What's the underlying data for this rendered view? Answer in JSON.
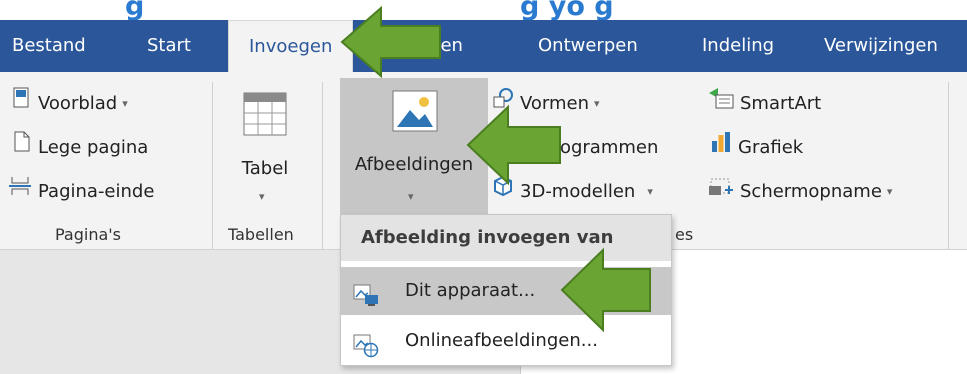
{
  "caption": {
    "left_text": "g",
    "right_text": "g yo   g"
  },
  "tabs": [
    "Bestand",
    "Start",
    "Invoegen",
    "enen",
    "Ontwerpen",
    "Indeling",
    "Verwijzingen"
  ],
  "ribbon": {
    "pages": {
      "cover": "Voorblad",
      "blank": "Lege pagina",
      "break": "Pagina-einde",
      "group": "Pagina's"
    },
    "tables": {
      "table": "Tabel",
      "group": "Tabellen"
    },
    "illustrations": {
      "pictures": "Afbeeldingen",
      "shapes": "Vormen",
      "icons": "ictogrammen",
      "models": "3D-modellen",
      "smartart": "SmartArt",
      "chart": "Grafiek",
      "screenshot": "Schermopname",
      "group_tail": "es"
    }
  },
  "menu": {
    "header": "Afbeelding invoegen van",
    "device": "Dit apparaat...",
    "online": "Onlineafbeeldingen..."
  },
  "colors": {
    "tabbar": "#2b579a",
    "ribbon": "#f3f3f3",
    "arrow": "#6aa533",
    "caption": "#2a7bd0"
  }
}
